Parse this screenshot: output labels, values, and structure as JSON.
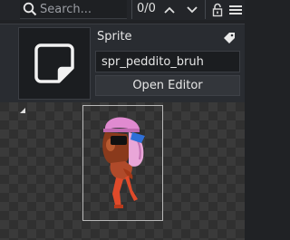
{
  "search": {
    "placeholder": "Search...",
    "count": "0/0"
  },
  "icons": {
    "search": "search-icon",
    "prev": "chevron-up-icon",
    "next": "chevron-down-icon",
    "lock": "lock-icon",
    "menu": "hamburger-menu-icon",
    "tag": "tag-icon",
    "thumb": "sprite-thumbnail-icon",
    "collapse": "collapse-triangle-icon"
  },
  "asset": {
    "type_label": "Sprite",
    "name": "spr_peddito_bruh",
    "open_editor_label": "Open Editor"
  },
  "colors": {
    "background": "#202225",
    "panel": "#292c31",
    "field": "#1b1d20",
    "text": "#e6e6e6"
  }
}
